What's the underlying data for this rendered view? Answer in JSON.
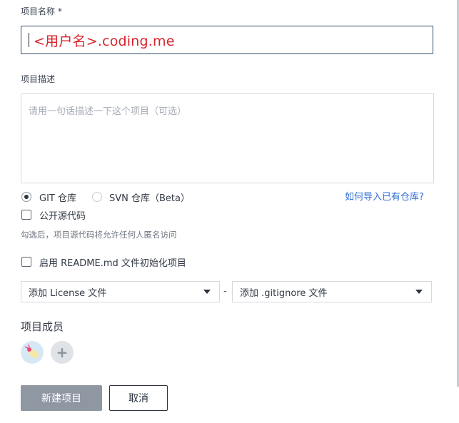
{
  "form": {
    "name_label": "项目名称 *",
    "name_value": "<用户名>.coding.me",
    "desc_label": "项目描述",
    "desc_placeholder": "请用一句话描述一下这个项目（可选）",
    "repo_types": [
      {
        "label": "GIT 仓库",
        "checked": true
      },
      {
        "label": "SVN 仓库（Beta）",
        "checked": false
      }
    ],
    "import_link": "如何导入已有仓库?",
    "public_source": {
      "label": "公开源代码",
      "checked": false
    },
    "public_hint": "勾选后，项目源代码将允许任何人匿名访问",
    "readme": {
      "label": "启用 README.md 文件初始化项目",
      "checked": false
    },
    "license_select": "添加 License 文件",
    "separator": "-",
    "gitignore_select": "添加 .gitignore 文件",
    "members_label": "项目成员",
    "add_member": "+"
  },
  "actions": {
    "create_label": "新建项目",
    "cancel_label": "取消"
  },
  "colors": {
    "accent_red": "#d8232a",
    "link_blue": "#2d6cd3",
    "primary_button": "#8f97a3"
  }
}
